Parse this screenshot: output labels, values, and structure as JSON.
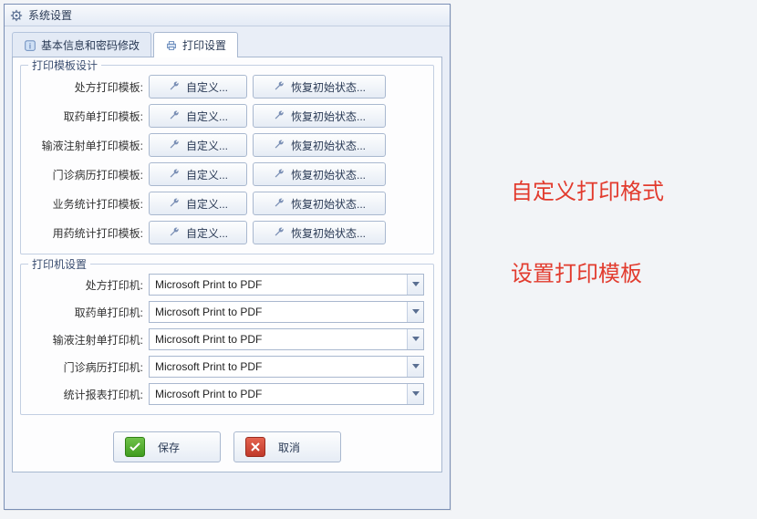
{
  "window": {
    "title": "系统设置"
  },
  "tabs": {
    "basic": "基本信息和密码修改",
    "print": "打印设置"
  },
  "group1": {
    "title": "打印模板设计",
    "rows": [
      {
        "label": "处方打印模板:"
      },
      {
        "label": "取药单打印模板:"
      },
      {
        "label": "输液注射单打印模板:"
      },
      {
        "label": "门诊病历打印模板:"
      },
      {
        "label": "业务统计打印模板:"
      },
      {
        "label": "用药统计打印模板:"
      }
    ],
    "customize_label": "自定义...",
    "restore_label": "恢复初始状态..."
  },
  "group2": {
    "title": "打印机设置",
    "rows": [
      {
        "label": "处方打印机:",
        "value": "Microsoft Print to PDF"
      },
      {
        "label": "取药单打印机:",
        "value": "Microsoft Print to PDF"
      },
      {
        "label": "输液注射单打印机:",
        "value": "Microsoft Print to PDF"
      },
      {
        "label": "门诊病历打印机:",
        "value": "Microsoft Print to PDF"
      },
      {
        "label": "统计报表打印机:",
        "value": "Microsoft Print to PDF"
      }
    ]
  },
  "footer": {
    "save": "保存",
    "cancel": "取消"
  },
  "annotations": {
    "a1": "自定义打印格式",
    "a2": "设置打印模板"
  }
}
